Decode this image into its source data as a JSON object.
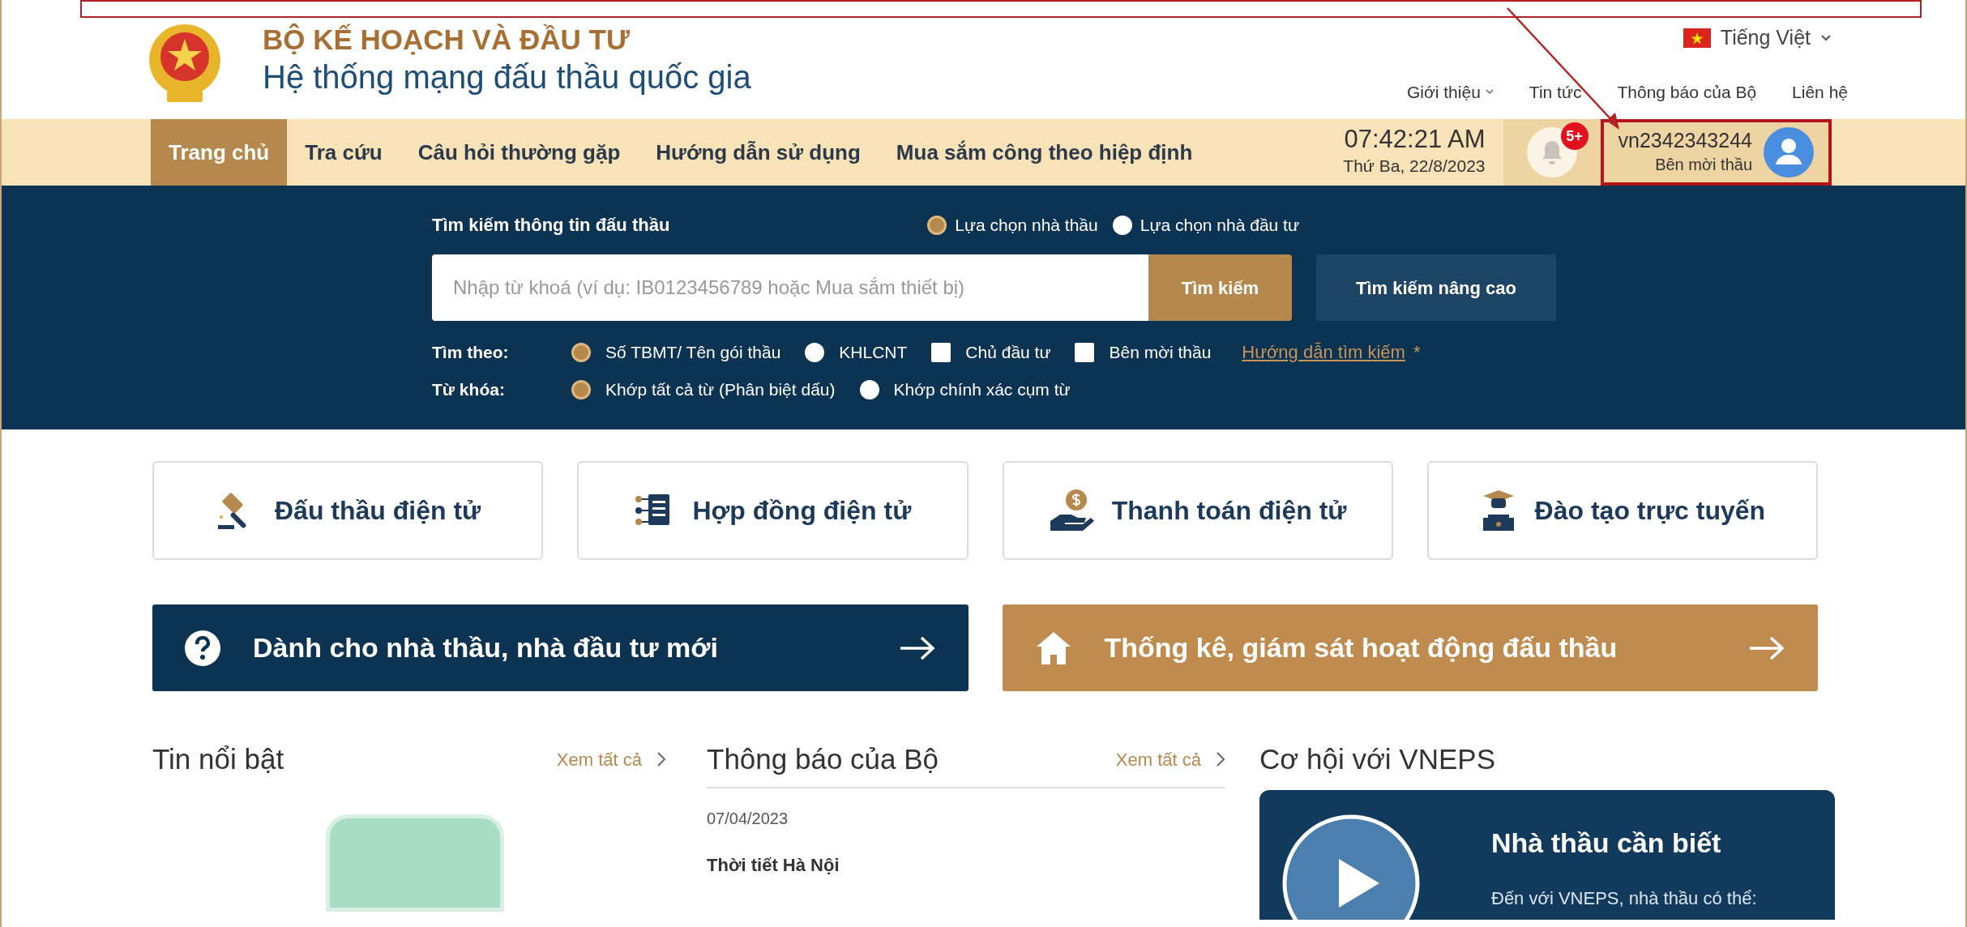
{
  "header": {
    "agency": "BỘ KẾ HOẠCH VÀ ĐẦU TƯ",
    "system_name": "Hệ thống mạng đấu thầu quốc gia",
    "language": "Tiếng Việt",
    "links": [
      {
        "label": "Giới thiệu",
        "dropdown": true
      },
      {
        "label": "Tin tức",
        "dropdown": false
      },
      {
        "label": "Thông báo của Bộ",
        "dropdown": false
      },
      {
        "label": "Liên hệ",
        "dropdown": false
      }
    ]
  },
  "nav": {
    "items": [
      {
        "label": "Trang chủ",
        "selected": true
      },
      {
        "label": "Tra cứu",
        "selected": false
      },
      {
        "label": "Câu hỏi thường gặp",
        "selected": false
      },
      {
        "label": "Hướng dẫn sử dụng",
        "selected": false
      },
      {
        "label": "Mua sắm công theo hiệp định",
        "selected": false
      }
    ],
    "time": "07:42:21 AM",
    "date": "Thứ Ba, 22/8/2023",
    "notification_badge": "5+",
    "user": {
      "id": "vn2342343244",
      "role": "Bên mời thầu",
      "highlighted": true
    }
  },
  "search": {
    "title": "Tìm kiếm thông tin đấu thầu",
    "modes": [
      {
        "label": "Lựa chọn nhà thầu",
        "selected": true
      },
      {
        "label": "Lựa chọn nhà đầu tư",
        "selected": false
      }
    ],
    "placeholder": "Nhập từ khoá (ví dụ: IB0123456789 hoặc Mua sắm thiết bị)",
    "button": "Tìm kiếm",
    "advanced_button": "Tìm kiếm nâng cao",
    "filters": [
      {
        "label": "Tìm theo:",
        "options": [
          {
            "kind": "radio",
            "label": "Số TBMT/ Tên gói thầu",
            "selected": true
          },
          {
            "kind": "radio",
            "label": "KHLCNT",
            "selected": false
          },
          {
            "kind": "checkbox",
            "label": "Chủ đầu tư",
            "checked": false
          },
          {
            "kind": "checkbox",
            "label": "Bên mời thầu",
            "checked": false
          }
        ]
      },
      {
        "label": "Từ khóa:",
        "options": [
          {
            "kind": "radio",
            "label": "Khớp tất cả từ (Phân biệt dấu)",
            "selected": true
          },
          {
            "kind": "radio",
            "label": "Khớp chính xác cụm từ",
            "selected": false
          }
        ]
      }
    ],
    "help_link": "Hướng dẫn tìm kiếm",
    "help_mark": "*"
  },
  "services": [
    {
      "label": "Đấu thầu điện tử"
    },
    {
      "label": "Hợp đồng điện tử"
    },
    {
      "label": "Thanh toán điện tử"
    },
    {
      "label": "Đào tạo trực tuyến"
    }
  ],
  "banners": [
    {
      "label": "Dành cho nhà thầu, nhà đầu tư mới",
      "color": "#0d3352"
    },
    {
      "label": "Thống kê, giám sát hoạt động đấu thầu",
      "color": "#bf8b4f"
    }
  ],
  "news": {
    "title": "Tin nổi bật",
    "more_link": "Xem tất cả"
  },
  "notices": {
    "title": "Thông báo của Bộ",
    "more_link": "Xem tất cả",
    "items": [
      {
        "date": "07/04/2023",
        "title": "Thời tiết Hà Nội"
      }
    ]
  },
  "opportunities": {
    "title": "Cơ hội với VNEPS",
    "card_heading": "Nhà thầu cần biết",
    "card_text": "Đến với VNEPS, nhà thầu có thể:"
  }
}
